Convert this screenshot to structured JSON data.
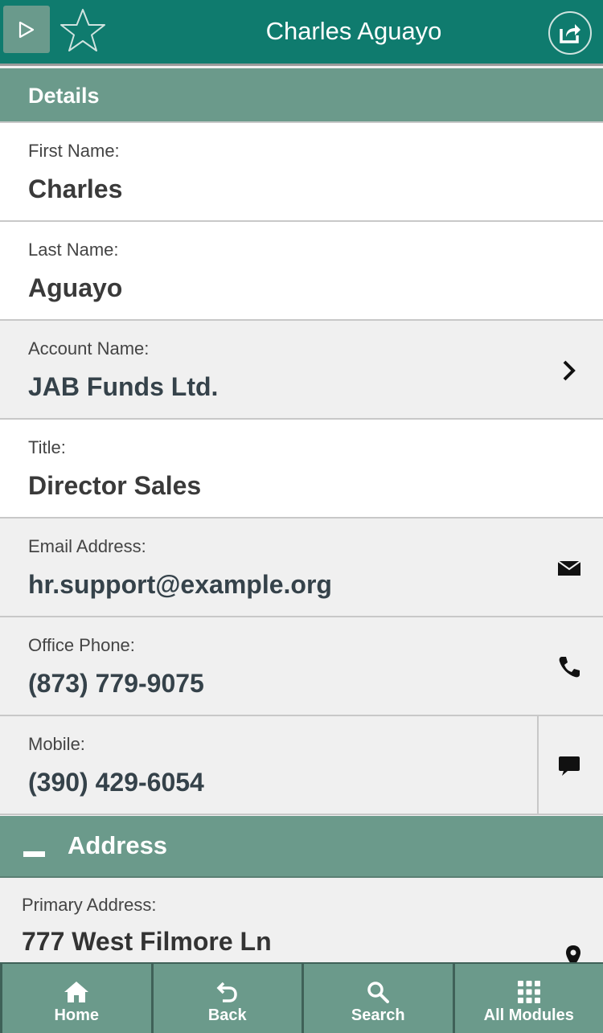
{
  "header": {
    "title": "Charles Aguayo",
    "play_icon": "play-icon",
    "favorite_icon": "star-outline-icon",
    "share_icon": "share-icon"
  },
  "details": {
    "header": "Details",
    "fields": {
      "first_name": {
        "label": "First Name:",
        "value": "Charles"
      },
      "last_name": {
        "label": "Last Name:",
        "value": "Aguayo"
      },
      "account_name": {
        "label": "Account Name:",
        "value": "JAB Funds Ltd.",
        "icon": "chevron-right-icon"
      },
      "title": {
        "label": "Title:",
        "value": "Director Sales"
      },
      "email": {
        "label": "Email Address:",
        "value": "hr.support@example.org",
        "icon": "envelope-icon"
      },
      "office_phone": {
        "label": "Office Phone:",
        "value": "(873) 779-9075",
        "icon": "phone-icon"
      },
      "mobile": {
        "label": "Mobile:",
        "value": "(390) 429-6054",
        "icon": "chat-bubble-icon"
      }
    }
  },
  "address": {
    "header": "Address",
    "collapse_icon": "minus-icon",
    "primary": {
      "label": "Primary Address:",
      "value": "777 West Filmore Ln",
      "icon": "map-pin-icon"
    }
  },
  "nav": {
    "home": "Home",
    "back": "Back",
    "search": "Search",
    "all_modules": "All Modules"
  },
  "colors": {
    "header_bg": "#0f7b6e",
    "section_bg": "#6b9a8b",
    "text_dark": "#333333"
  }
}
